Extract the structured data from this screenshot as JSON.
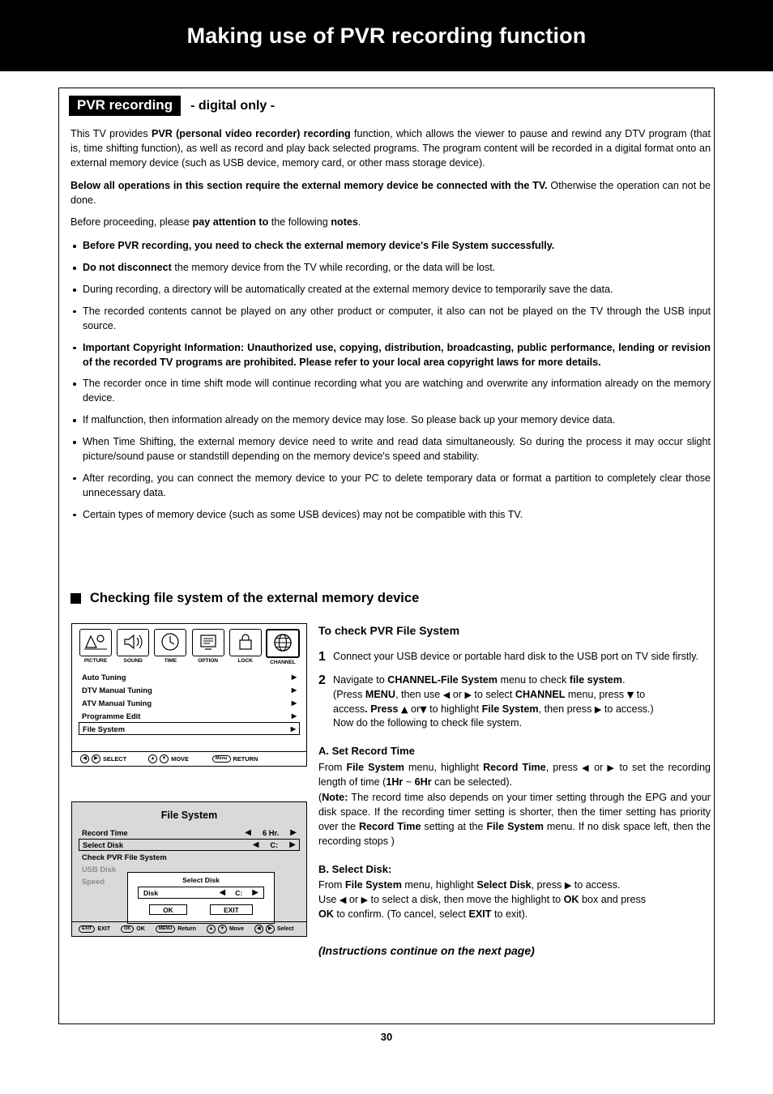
{
  "header": {
    "title": "Making use of PVR recording function"
  },
  "section": {
    "badge": "PVR recording",
    "subtitle": "- digital only -"
  },
  "intro": {
    "p1_a": "This TV provides ",
    "p1_b": "PVR (personal video recorder) recording",
    "p1_c": " function, which allows the viewer to pause and rewind any DTV program (that is, time shifting function), as well as record and play back selected programs. The program content will be recorded in a digital format onto an external memory device (such as USB device, memory card, or other mass storage device).",
    "p2_b": "Below all operations in this section require the external memory device be connected with the TV.",
    "p2_c": " Otherwise the operation can not be done.",
    "p3_a": "Before proceeding, please ",
    "p3_b": "pay attention to",
    "p3_c": " the following ",
    "p3_d": "notes",
    "p3_e": "."
  },
  "notes": [
    {
      "bold": "Before PVR recording, you need to check the external memory device's File System successfully.",
      "rest": ""
    },
    {
      "bold": "Do not disconnect",
      "rest": " the memory device from the TV while recording, or the data will be lost."
    },
    {
      "bold": "",
      "rest": "During recording, a directory will be automatically created at the external memory device to temporarily save the data."
    },
    {
      "bold": "",
      "rest": "The recorded contents cannot be played on any other product or computer, it also can not be played on the TV through the USB input source."
    },
    {
      "bold": "Important Copyright Information: Unauthorized use, copying, distribution, broadcasting, public performance, lending or revision of the recorded TV programs are prohibited. Please refer to your local area copyright laws for more details.",
      "rest": ""
    },
    {
      "bold": "",
      "rest": "The recorder once in time shift mode will continue recording what you are watching and overwrite any information already on the memory device."
    },
    {
      "bold": "",
      "rest": "If malfunction, then information already on the memory device may lose. So please back up your memory device data."
    },
    {
      "bold": "",
      "rest": "When Time Shifting, the external memory device need to write and read data simultaneously. So during the process it may occur slight picture/sound pause or standstill depending on the memory device's speed and stability."
    },
    {
      "bold": "",
      "rest": "After recording, you can connect the memory device to your PC to delete temporary data or format a partition to completely clear those unnecessary data."
    },
    {
      "bold": "",
      "rest": "Certain types of memory device (such as some USB devices) may not be compatible with this TV."
    }
  ],
  "subhead": {
    "title": "Checking file system of the external memory device"
  },
  "osd_menu": {
    "icons": [
      {
        "label": "PICTURE",
        "icon": "picture-icon"
      },
      {
        "label": "SOUND",
        "icon": "sound-icon"
      },
      {
        "label": "TIME",
        "icon": "clock-icon"
      },
      {
        "label": "OPTION",
        "icon": "option-icon"
      },
      {
        "label": "LOCK",
        "icon": "lock-icon"
      },
      {
        "label": "CHANNEL",
        "icon": "globe-icon"
      }
    ],
    "items": [
      {
        "label": "Auto Tuning",
        "arrow": "▶"
      },
      {
        "label": "DTV Manual Tuning",
        "arrow": "▶"
      },
      {
        "label": "ATV Manual Tuning",
        "arrow": "▶"
      },
      {
        "label": "Programme Edit",
        "arrow": "▶"
      },
      {
        "label": "File System",
        "arrow": "▶"
      }
    ],
    "footer": [
      {
        "keys": "◀▶",
        "label": "SELECT"
      },
      {
        "keys": "▲▼",
        "label": "MOVE"
      },
      {
        "keys": "Menu",
        "label": "RETURN"
      }
    ]
  },
  "osd_filesystem": {
    "title": "File System",
    "rows": [
      {
        "label": "Record Time",
        "value": "6 Hr.",
        "left": "◀",
        "right": "▶"
      },
      {
        "label": "Select Disk",
        "value": "C:",
        "left": "◀",
        "right": "▶"
      },
      {
        "label": "Check PVR File System",
        "value": "",
        "left": "",
        "right": ""
      },
      {
        "label": "USB Disk",
        "value": "",
        "left": "",
        "right": ""
      },
      {
        "label": "Speed",
        "value": "",
        "left": "",
        "right": ""
      }
    ],
    "dialog": {
      "title": "Select Disk",
      "field_label": "Disk",
      "field_value": "C:",
      "field_left": "◀",
      "field_right": "▶",
      "ok": "OK",
      "exit": "EXIT"
    },
    "footer": [
      {
        "key": "EXIT",
        "label": "EXIT"
      },
      {
        "key": "OK",
        "label": "OK"
      },
      {
        "key": "MENU",
        "label": "Return"
      },
      {
        "key": "▲▼",
        "label": "Move"
      },
      {
        "key": "◀▶",
        "label": "Select"
      }
    ]
  },
  "instructions": {
    "heading": "To check PVR File System",
    "step1": {
      "num": "1",
      "text": "Connect your USB device or portable hard disk to the USB port on TV side firstly."
    },
    "step2": {
      "num": "2",
      "t1": "Navigate to ",
      "b1": "CHANNEL-File System",
      "t2": " menu to check ",
      "b2": "file system",
      "t3": ".",
      "l2_t1": "(Press ",
      "l2_b1": "MENU",
      "l2_t2": ", then use ",
      "l2_a1": "◀",
      "l2_t3": " or ",
      "l2_a2": "▶",
      "l2_t4": " to select ",
      "l2_b2": "CHANNEL",
      "l2_t5": " menu, press ",
      "l2_a3": "▼",
      "l2_t6": " to",
      "l3_t1": "access",
      "l3_b1": ". Press ",
      "l3_a1": "▲",
      "l3_t2": " or",
      "l3_a2": "▼",
      "l3_t3": "  to highlight ",
      "l3_b2": "File System",
      "l3_t4": ", then press ",
      "l3_a3": "▶",
      "l3_t5": " to access.)",
      "l4": "Now do the following to check file system."
    },
    "sectionA": {
      "heading": "A. Set Record Time",
      "t1": "From ",
      "b1": "File System",
      "t2": " menu, highlight ",
      "b2": "Record Time",
      "t3": ", press ",
      "a1": "◀",
      "t4": " or ",
      "a2": "▶",
      "t5": " to set the recording length of time (",
      "b3": "1Hr",
      "t6": " ~ ",
      "b4": "6Hr",
      "t7": " can be selected).",
      "n1": "(",
      "nb": "Note:",
      "n2": " The record time also depends on your timer setting through the EPG and your disk space. If the recording timer setting is shorter, then the timer setting has priority over the ",
      "nb2": "Record Time",
      "n3": " setting at the ",
      "nb3": "File System",
      "n4": " menu. If no disk space left, then the recording stops )"
    },
    "sectionB": {
      "heading": "B. Select Disk:",
      "t1": "From ",
      "b1": "File System",
      "t2": " menu, highlight ",
      "b2": "Select Disk",
      "t3": ", press ",
      "a1": "▶",
      "t4": " to access.",
      "l2_t1": "Use ",
      "l2_a1": "◀",
      "l2_t2": " or ",
      "l2_a2": "▶",
      "l2_t3": " to select a disk, then move the highlight to ",
      "l2_b1": "OK",
      "l2_t4": " box and press",
      "l3_b1": "OK",
      "l3_t1": " to confirm. (To cancel, select ",
      "l3_b2": "EXIT",
      "l3_t2": " to exit)."
    },
    "continue": "(Instructions continue on the next page)"
  },
  "page_number": "30"
}
